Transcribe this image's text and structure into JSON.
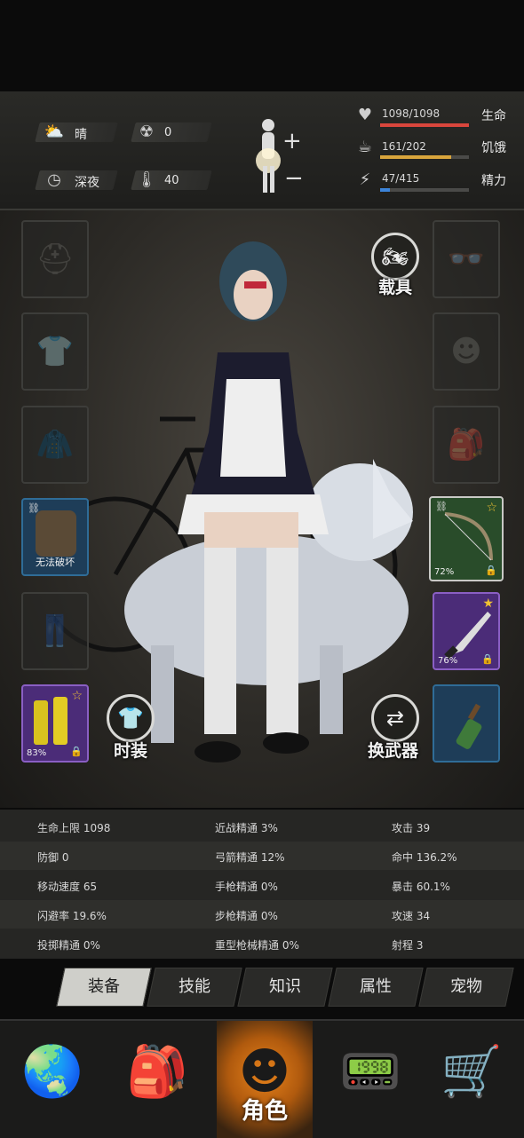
{
  "status": {
    "weather": "晴",
    "radiation": "0",
    "time_of_day": "深夜",
    "temperature": "40",
    "icons": {
      "weather": "sun-cloud-icon",
      "radiation": "radiation-icon",
      "clock": "clock-icon",
      "thermometer": "thermometer-icon",
      "body": "body-figure-icon"
    }
  },
  "vitals": [
    {
      "value": "1098/1098",
      "label": "生命",
      "fill": 1.0,
      "color": "#d9463c",
      "icon": "heart-icon"
    },
    {
      "value": "161/202",
      "label": "饥饿",
      "fill": 0.8,
      "color": "#d9a53c",
      "icon": "stomach-icon"
    },
    {
      "value": "47/415",
      "label": "精力",
      "fill": 0.11,
      "color": "#3c84d9",
      "icon": "lightning-icon"
    }
  ],
  "equipment": {
    "vehicle_label": "载具",
    "outfit_label": "时装",
    "swap_weapon_label": "换武器",
    "backpack_caption": "无法破坏",
    "bow_percent": "72%",
    "blade_percent": "76%",
    "boots_percent": "83%"
  },
  "stats": [
    [
      "生命上限 1098",
      "近战精通 3%",
      "攻击 39"
    ],
    [
      "防御 0",
      "弓箭精通 12%",
      "命中 136.2%"
    ],
    [
      "移动速度 65",
      "手枪精通 0%",
      "暴击 60.1%"
    ],
    [
      "闪避率 19.6%",
      "步枪精通 0%",
      "攻速 34"
    ],
    [
      "投掷精通 0%",
      "重型枪械精通 0%",
      "射程 3"
    ]
  ],
  "tabs": [
    "装备",
    "技能",
    "知识",
    "属性",
    "宠物"
  ],
  "active_tab": "装备",
  "nav": {
    "active_label": "角色",
    "items": [
      "globe-map-icon",
      "backpack-icon",
      "character-head-icon",
      "walkie-talkie-icon",
      "shopping-cart-icon"
    ]
  },
  "colors": {
    "accent_orange": "#e8831b",
    "purple_rarity": "#4b2c78",
    "blue_rarity": "#1e3d58",
    "green_rarity": "#294c2a"
  }
}
